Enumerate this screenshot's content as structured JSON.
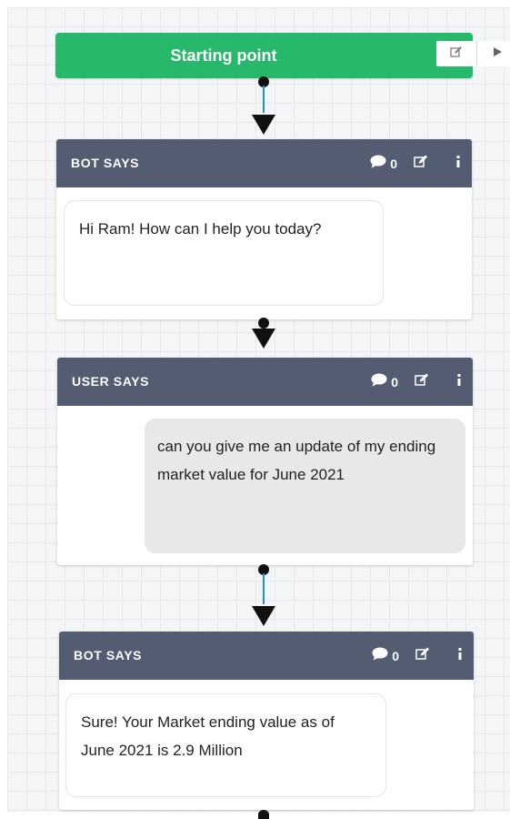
{
  "start": {
    "title": "Starting point",
    "edit_icon": "edit-icon",
    "play_icon": "play-icon"
  },
  "nodes": [
    {
      "type_label": "BOT SAYS",
      "comment_count": "0",
      "message": "Hi Ram! How can I help you today?"
    },
    {
      "type_label": "USER SAYS",
      "comment_count": "0",
      "message": "can you give me an update of my ending market value for June 2021"
    },
    {
      "type_label": "BOT SAYS",
      "comment_count": "0",
      "message": "Sure! Your Market ending value as of June 2021 is 2.9 Million"
    }
  ],
  "colors": {
    "start_green": "#27b86c",
    "header_slate": "#545c72",
    "connector_blue": "#1e8ee0",
    "user_bubble": "#e8e8e8"
  },
  "icons": [
    "edit-icon",
    "play-icon",
    "comment-icon",
    "more-vertical-icon",
    "arrow-down-icon"
  ]
}
